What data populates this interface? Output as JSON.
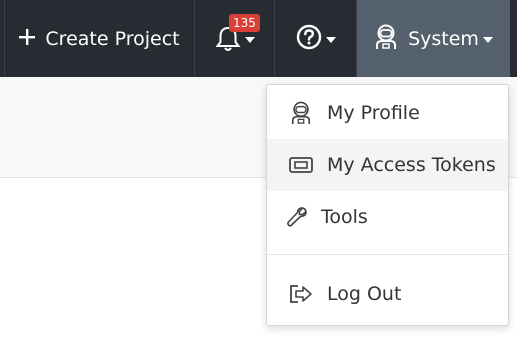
{
  "topbar": {
    "create_project": {
      "label": "Create Project",
      "icon": "plus-icon"
    },
    "notifications": {
      "count": "135",
      "icon": "bell-icon"
    },
    "help": {
      "icon": "question-circle-icon"
    },
    "system": {
      "label": "System",
      "icon": "astronaut-icon"
    }
  },
  "menu": {
    "items": [
      {
        "label": "My Profile",
        "icon": "astronaut-icon"
      },
      {
        "label": "My Access Tokens",
        "icon": "ticket-icon"
      },
      {
        "label": "Tools",
        "icon": "wrench-icon"
      },
      {
        "label": "Log Out",
        "icon": "sign-out-icon"
      }
    ]
  },
  "colors": {
    "topbar_bg": "#262c32",
    "system_active_bg": "#54606c",
    "badge_bg": "#d9403a",
    "menu_hover_bg": "#f4f4f4"
  }
}
